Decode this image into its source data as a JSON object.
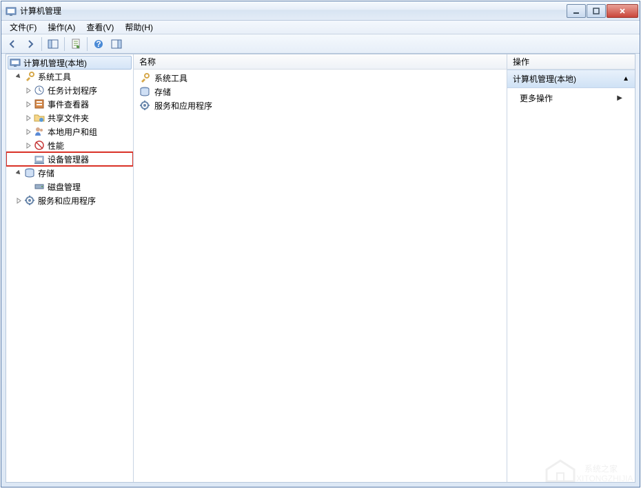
{
  "window": {
    "title": "计算机管理"
  },
  "menubar": {
    "file": "文件(F)",
    "action": "操作(A)",
    "view": "查看(V)",
    "help": "帮助(H)"
  },
  "tree": {
    "root": {
      "label": "计算机管理(本地)",
      "children": [
        {
          "label": "系统工具",
          "children": [
            {
              "label": "任务计划程序"
            },
            {
              "label": "事件查看器"
            },
            {
              "label": "共享文件夹"
            },
            {
              "label": "本地用户和组"
            },
            {
              "label": "性能"
            },
            {
              "label": "设备管理器",
              "highlighted": true
            }
          ]
        },
        {
          "label": "存储",
          "children": [
            {
              "label": "磁盘管理"
            }
          ]
        },
        {
          "label": "服务和应用程序"
        }
      ]
    }
  },
  "list": {
    "header": "名称",
    "items": [
      {
        "label": "系统工具"
      },
      {
        "label": "存储"
      },
      {
        "label": "服务和应用程序"
      }
    ]
  },
  "actions": {
    "header": "操作",
    "group_title": "计算机管理(本地)",
    "more": "更多操作"
  },
  "watermark": "系统之家"
}
